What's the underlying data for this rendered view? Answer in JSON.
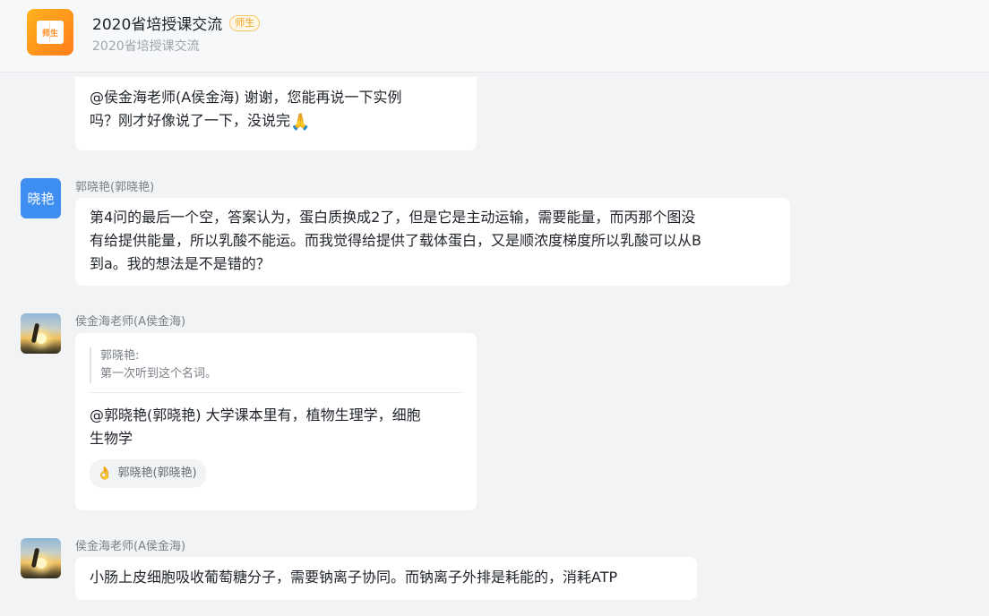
{
  "header": {
    "group_icon_label": "师生",
    "title": "2020省培授课交流",
    "role_badge": "师生",
    "subtitle": "2020省培授课交流"
  },
  "messages": [
    {
      "lines": [
        "@侯金海老师(A侯金海) 谢谢，您能再说一下实例",
        "吗？刚才好像说了一下，没说完"
      ],
      "emoji": "🙏"
    },
    {
      "sender": "郭晓艳(郭晓艳)",
      "avatar_text": "晓艳",
      "lines": [
        "第4问的最后一个空，答案认为，蛋白质换成2了，但是它是主动运输，需要能量，而丙那个图没",
        "有给提供能量，所以乳酸不能运。而我觉得给提供了载体蛋白，又是顺浓度梯度所以乳酸可以从B",
        "到a。我的想法是不是错的？"
      ]
    },
    {
      "sender": "侯金海老师(A侯金海)",
      "quote_author": "郭晓艳:",
      "quote_text": "第一次听到这个名词。",
      "lines": [
        "@郭晓艳(郭晓艳) 大学课本里有，植物生理学，细胞",
        "生物学"
      ],
      "reaction_icon": "ok-hand-icon",
      "reaction_user": "郭晓艳(郭晓艳)"
    },
    {
      "sender": "侯金海老师(A侯金海)",
      "lines": [
        "小肠上皮细胞吸收葡萄糖分子，需要钠离子协同。而钠离子外排是耗能的，消耗ATP"
      ]
    }
  ]
}
